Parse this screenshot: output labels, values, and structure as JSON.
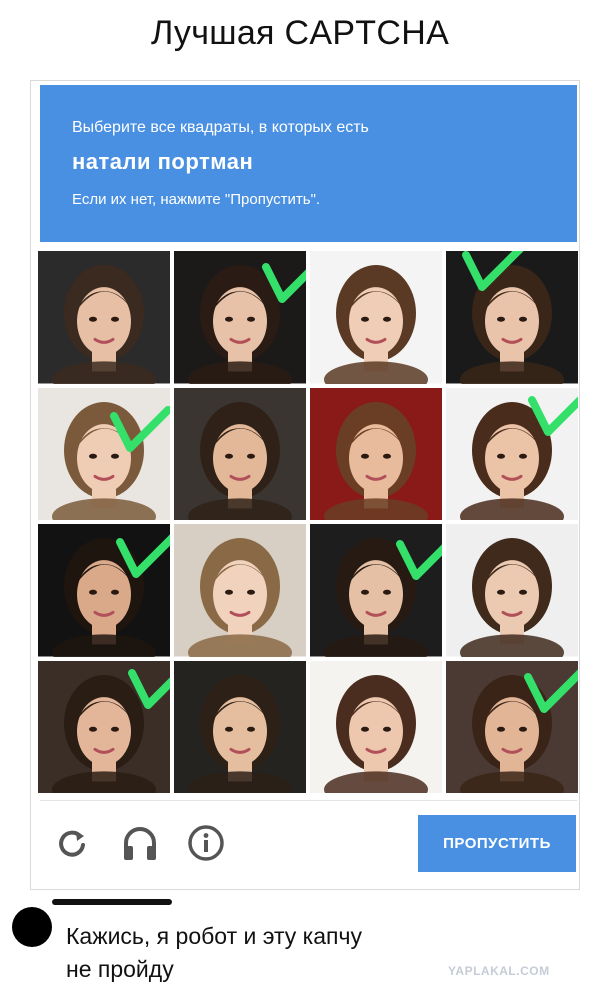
{
  "meme_title": "Лучшая CAPTCHA",
  "captcha": {
    "instruction_line1": "Выберите все квадраты, в которых есть",
    "target": "натали портман",
    "instruction_line3": "Если их нет, нажмите \"Пропустить\".",
    "skip_label": "ПРОПУСТИТЬ",
    "accent_color": "#4a90e2",
    "check_color": "#35e06a",
    "footer_icons": [
      "reload-icon",
      "headphones-icon",
      "info-icon"
    ],
    "tiles": [
      {
        "photo": "woman-portrait",
        "selected": false
      },
      {
        "photo": "woman-portrait",
        "selected": true
      },
      {
        "photo": "woman-portrait",
        "selected": false
      },
      {
        "photo": "woman-portrait",
        "selected": true
      },
      {
        "photo": "woman-portrait",
        "selected": true
      },
      {
        "photo": "woman-portrait",
        "selected": false
      },
      {
        "photo": "woman-portrait",
        "selected": false
      },
      {
        "photo": "woman-portrait",
        "selected": true
      },
      {
        "photo": "woman-portrait",
        "selected": true
      },
      {
        "photo": "woman-portrait",
        "selected": false
      },
      {
        "photo": "woman-portrait",
        "selected": true
      },
      {
        "photo": "woman-portrait",
        "selected": false
      },
      {
        "photo": "woman-portrait",
        "selected": true
      },
      {
        "photo": "woman-portrait",
        "selected": false
      },
      {
        "photo": "woman-portrait",
        "selected": false
      },
      {
        "photo": "woman-portrait",
        "selected": true
      }
    ]
  },
  "comment": {
    "text_line1": "Кажись, я робот и эту  капчу",
    "text_line2": "не пройду"
  },
  "watermark": "YAPLAKAL.COM"
}
